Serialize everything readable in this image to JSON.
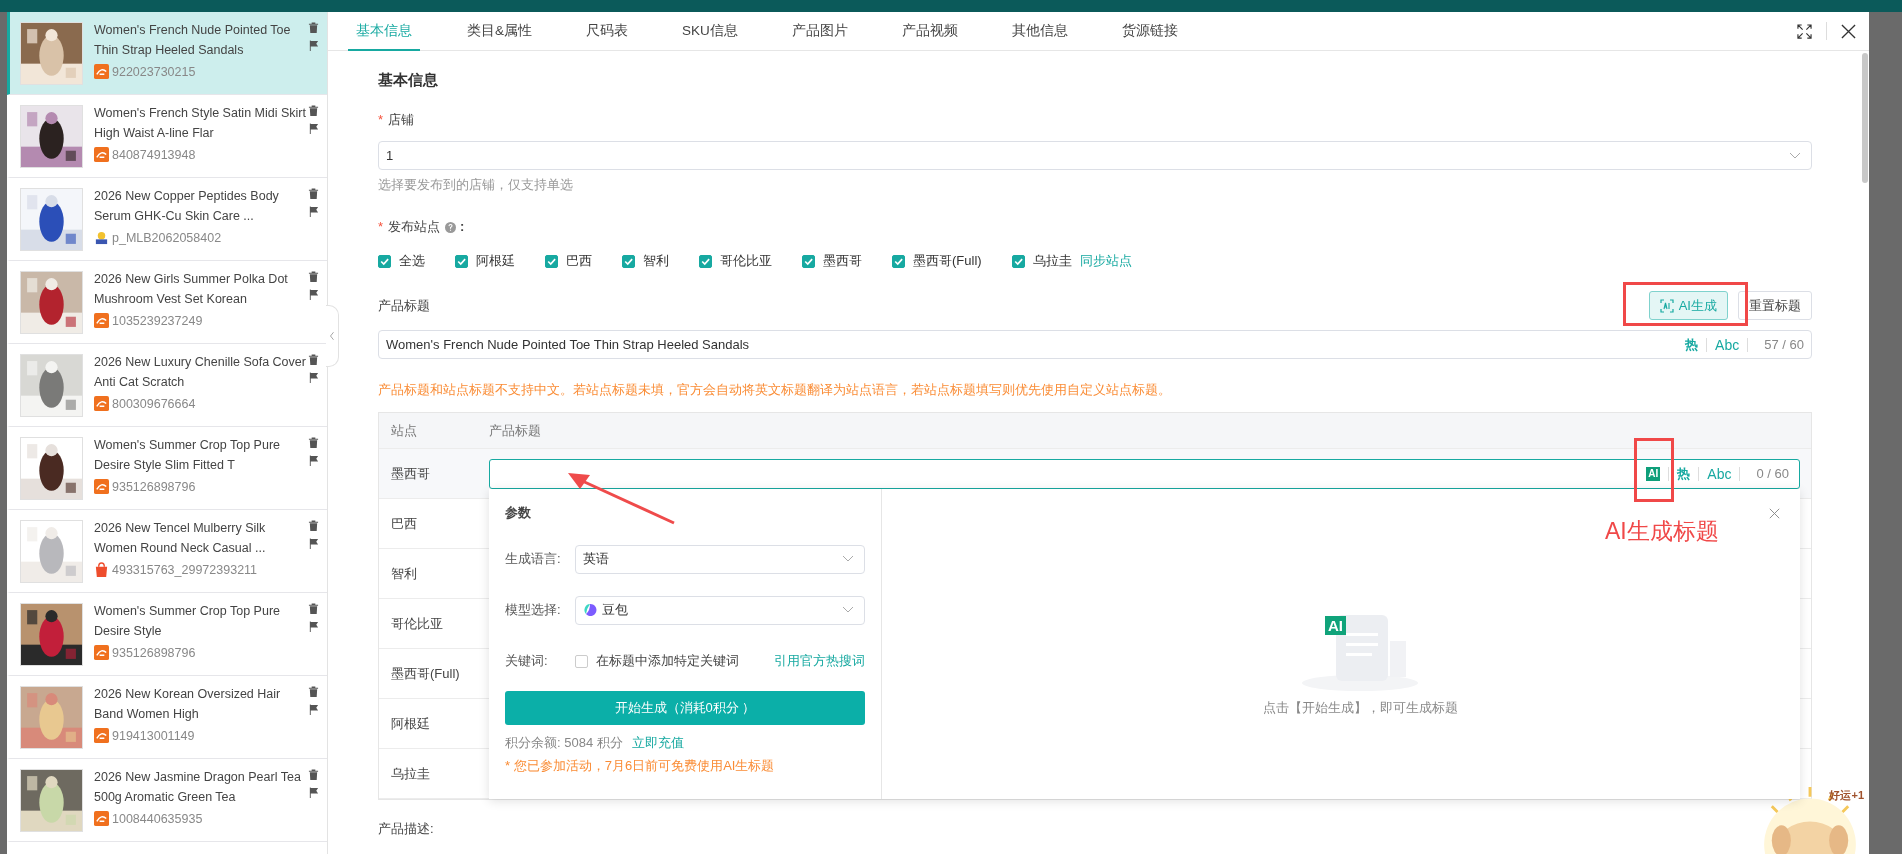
{
  "sidebar": {
    "items": [
      {
        "title": "Women's French Nude Pointed Toe Thin Strap Heeled Sandals",
        "id": "922023730215",
        "kind": "alibaba",
        "selected": true
      },
      {
        "title": "Women's French Style Satin Midi Skirt High Waist A-line Flar",
        "id": "840874913948",
        "kind": "alibaba",
        "selected": false
      },
      {
        "title": "2026 New Copper Peptides Body Serum GHK-Cu Skin Care ...",
        "id": "p_MLB2062058402",
        "kind": "other",
        "selected": false
      },
      {
        "title": "2026 New Girls Summer Polka Dot Mushroom Vest Set Korean",
        "id": "1035239237249",
        "kind": "alibaba",
        "selected": false
      },
      {
        "title": "2026 New Luxury Chenille Sofa Cover Anti Cat Scratch",
        "id": "800309676664",
        "kind": "alibaba",
        "selected": false
      },
      {
        "title": "Women's Summer Crop Top Pure Desire Style Slim Fitted T",
        "id": "935126898796",
        "kind": "alibaba",
        "selected": false
      },
      {
        "title": "2026 New Tencel Mulberry Silk Women Round Neck Casual ...",
        "id": "493315763_29972393211",
        "kind": "shopee",
        "selected": false
      },
      {
        "title": "Women's Summer Crop Top Pure Desire Style",
        "id": "935126898796",
        "kind": "alibaba",
        "selected": false
      },
      {
        "title": "2026 New Korean Oversized Hair Band Women High",
        "id": "919413001149",
        "kind": "alibaba",
        "selected": false
      },
      {
        "title": "2026 New Jasmine Dragon Pearl Tea 500g Aromatic Green Tea",
        "id": "1008440635935",
        "kind": "alibaba",
        "selected": false
      }
    ]
  },
  "tabs": [
    {
      "label": "基本信息",
      "selected": true
    },
    {
      "label": "类目&属性",
      "selected": false
    },
    {
      "label": "尺码表",
      "selected": false
    },
    {
      "label": "SKU信息",
      "selected": false
    },
    {
      "label": "产品图片",
      "selected": false
    },
    {
      "label": "产品视频",
      "selected": false
    },
    {
      "label": "其他信息",
      "selected": false
    },
    {
      "label": "货源链接",
      "selected": false
    }
  ],
  "form": {
    "section_title": "基本信息",
    "store": {
      "label": "店铺",
      "required_mark": "*",
      "value": "1",
      "hint": "选择要发布到的店铺，仅支持单选"
    },
    "sites": {
      "label": "发布站点",
      "required_mark": "*",
      "label_suffix": ":",
      "options": [
        {
          "label": "全选",
          "checked": true
        },
        {
          "label": "阿根廷",
          "checked": true
        },
        {
          "label": "巴西",
          "checked": true
        },
        {
          "label": "智利",
          "checked": true
        },
        {
          "label": "哥伦比亚",
          "checked": true
        },
        {
          "label": "墨西哥",
          "checked": true
        },
        {
          "label": "墨西哥(Full)",
          "checked": true
        },
        {
          "label": "乌拉圭",
          "checked": true
        }
      ],
      "sync_link": "同步站点"
    },
    "title": {
      "label": "产品标题",
      "ai_button": "AI生成",
      "reset_button": "重置标题",
      "value": "Women's French Nude Pointed Toe Thin Strap Heeled Sandals",
      "hot": "热",
      "abc": "Abc",
      "count": "57 / 60"
    },
    "warning": "产品标题和站点标题不支持中文。若站点标题未填，官方会自动将英文标题翻译为站点语言，若站点标题填写则优先使用自定义站点标题。",
    "site_table": {
      "columns": [
        "站点",
        "产品标题"
      ],
      "rows": [
        {
          "site": "墨西哥"
        },
        {
          "site": "巴西"
        },
        {
          "site": "智利"
        },
        {
          "site": "哥伦比亚"
        },
        {
          "site": "墨西哥(Full)"
        },
        {
          "site": "阿根廷"
        },
        {
          "site": "乌拉圭"
        }
      ],
      "active_input": {
        "ai_badge": "AI",
        "hot": "热",
        "abc": "Abc",
        "count": "0 / 60"
      }
    },
    "description_label": "产品描述:"
  },
  "ai_popup": {
    "params_title": "参数",
    "language": {
      "label": "生成语言:",
      "value": "英语"
    },
    "model": {
      "label": "模型选择:",
      "value": "豆包"
    },
    "keyword": {
      "label": "关键词:",
      "checkbox_label": "在标题中添加特定关键词",
      "checked": false,
      "link": "引用官方热搜词"
    },
    "generate_button": "开始生成（消耗0积分 ）",
    "balance": "积分余额: 5084 积分",
    "recharge_link": "立即充值",
    "notice": "* 您已参加活动，7月6日前可免费使用AI生标题",
    "empty_badge": "AI",
    "empty_text": "点击【开始生成】，即可生成标题"
  },
  "annotation": {
    "text": "AI生成标题"
  },
  "mascot": {
    "text": "好运+1"
  }
}
